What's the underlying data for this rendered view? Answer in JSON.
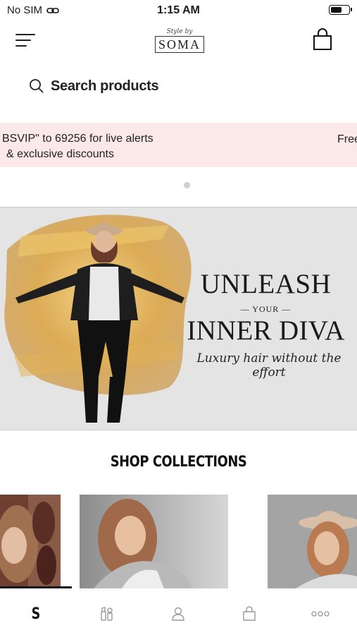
{
  "status_bar": {
    "carrier": "No SIM",
    "time": "1:15 AM"
  },
  "header": {
    "logo_script": "Style by",
    "logo_name": "SOMA"
  },
  "search": {
    "placeholder": "Search products"
  },
  "promo": {
    "line1": "BSVIP\" to 69256 for live alerts",
    "line2": "& exclusive discounts",
    "next_peek": "Free"
  },
  "hero": {
    "title_line1": "UNLEASH",
    "title_small": "— YOUR —",
    "title_line2": "INNER DIVA",
    "tagline": "Luxury hair without the effort"
  },
  "collections": {
    "title": "SHOP COLLECTIONS"
  },
  "tabbar": {
    "items": [
      {
        "label": "S",
        "icon": "home-logo-icon",
        "active": true
      },
      {
        "label": "",
        "icon": "beauty-tools-icon",
        "active": false
      },
      {
        "label": "",
        "icon": "account-icon",
        "active": false
      },
      {
        "label": "",
        "icon": "bag-icon",
        "active": false
      },
      {
        "label": "",
        "icon": "more-icon",
        "active": false
      }
    ]
  },
  "colors": {
    "promo_bg": "#fbe9e9",
    "hero_bg": "#e4e4e4",
    "gold": "#d9a64a"
  }
}
